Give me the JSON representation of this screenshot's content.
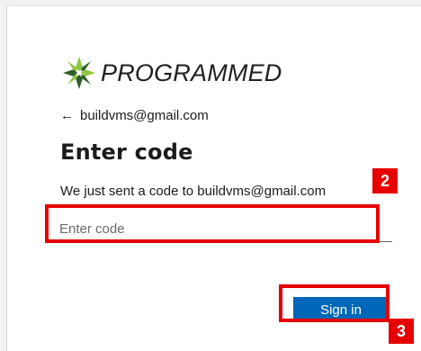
{
  "brand": {
    "logo_text": "PROGRAMMED",
    "icon": "star-burst-logo-icon"
  },
  "account": {
    "back_icon": "arrow-left-icon",
    "email": "buildvms@gmail.com"
  },
  "heading": "Enter code",
  "message": "We just sent a code to buildvms@gmail.com",
  "code_field": {
    "placeholder": "Enter code",
    "value": ""
  },
  "actions": {
    "sign_in_label": "Sign in"
  },
  "annotations": {
    "step_input": "2",
    "step_button": "3",
    "highlight_color": "#e60000"
  },
  "colors": {
    "primary_button": "#0067b8",
    "logo_green": "#8dc63f",
    "logo_dark": "#2e5e2a"
  }
}
